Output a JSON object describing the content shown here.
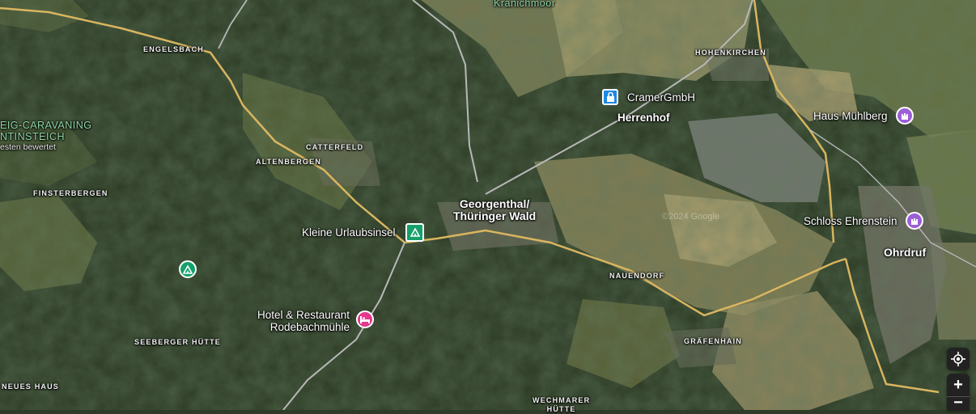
{
  "colors": {
    "road_major": "#e6c06a",
    "road_minor": "#c9c9c9",
    "camp_pin": "#16a06b",
    "hotel_pin": "#e4388d",
    "castle_pin": "#9b5fd6",
    "shop_pin": "#1e88e5",
    "green_label": "#8fd6a8"
  },
  "labels": {
    "kranichmoor": "Kranichmoor",
    "engelsbach": "ENGELSBACH",
    "caravan_line1": "EIG-CARAVANING",
    "caravan_line2": "NTINSTEICH",
    "caravan_rating": "esten bewertet",
    "catterfeld": "CATTERFELD",
    "altenbergen": "ALTENBERGEN",
    "finsterbergen": "FINSTERBERGEN",
    "hohenkirchen": "HOHENKIRCHEN",
    "cramer": "CramerGmbH",
    "herrenhof": "Herrenhof",
    "haus_muehlberg": "Haus Mühlberg",
    "georgenthal_line1": "Georgenthal/",
    "georgenthal_line2": "Thüringer Wald",
    "kleine_urlaubsinsel": "Kleine Urlaubsinsel",
    "schloss": "Schloss Ehrenstein",
    "ohrdruf": "Ohrdruf",
    "nauendorf": "NAUENDORF",
    "hotel_line1": "Hotel & Restaurant",
    "hotel_line2": "Rodebachmühle",
    "seeberger": "SEEBERGER HÜTTE",
    "graefenhain": "GRÄFENHAIN",
    "neues_haus": "NEUES HAUS",
    "wechmarer_line1": "WECHMARER",
    "wechmarer_line2": "HÜTTE",
    "copyright": "©2024 Google"
  },
  "controls": {
    "locate_icon": "crosshair-icon",
    "zoom_in": "+",
    "zoom_out": "−"
  }
}
